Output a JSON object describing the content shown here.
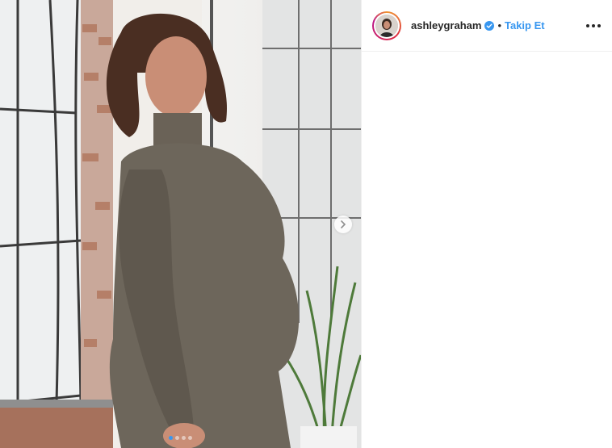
{
  "header": {
    "username": "ashleygraham",
    "separator": "•",
    "follow_label": "Takip Et"
  },
  "carousel": {
    "slides": 4,
    "active_index": 0
  },
  "icons": {
    "verified": "verified-badge-icon",
    "next": "chevron-right-icon",
    "more": "more-options-icon"
  },
  "colors": {
    "accent": "#3897f0",
    "text": "#262626",
    "border": "#efefef"
  }
}
